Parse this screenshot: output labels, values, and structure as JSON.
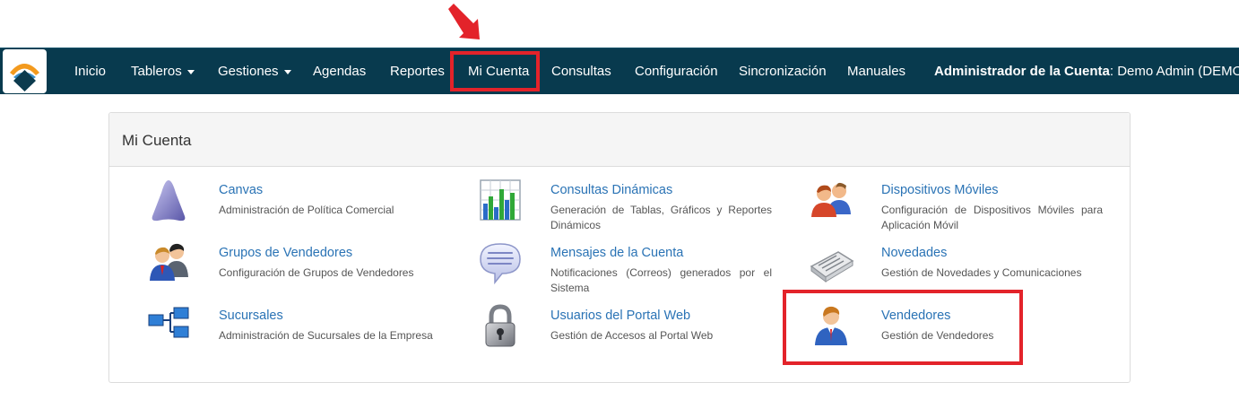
{
  "nav": {
    "items": [
      {
        "label": "Inicio",
        "dropdown": false
      },
      {
        "label": "Tableros",
        "dropdown": true
      },
      {
        "label": "Gestiones",
        "dropdown": true
      },
      {
        "label": "Agendas",
        "dropdown": false
      },
      {
        "label": "Reportes",
        "dropdown": false
      },
      {
        "label": "Mi Cuenta",
        "dropdown": false
      },
      {
        "label": "Consultas",
        "dropdown": false
      },
      {
        "label": "Configuración",
        "dropdown": false
      },
      {
        "label": "Sincronización",
        "dropdown": false
      },
      {
        "label": "Manuales",
        "dropdown": false
      }
    ],
    "account_role": "Administrador de la Cuenta",
    "account_user": ": Demo Admin (DEMO)"
  },
  "panel": {
    "title": "Mi Cuenta",
    "entries": [
      {
        "title": "Canvas",
        "desc": "Administración de Política Comercial",
        "icon": "canvas-icon"
      },
      {
        "title": "Consultas Dinámicas",
        "desc": "Generación de Tablas, Gráficos y Reportes Dinámicos",
        "icon": "bar-chart-icon"
      },
      {
        "title": "Dispositivos Móviles",
        "desc": "Configuración de Dispositivos Móviles para Aplicación Móvil",
        "icon": "users-pair-icon"
      },
      {
        "title": "Grupos de Vendedores",
        "desc": "Configuración de Grupos de Vendedores",
        "icon": "business-group-icon"
      },
      {
        "title": "Mensajes de la Cuenta",
        "desc": "Notificaciones (Correos) generados por el Sistema",
        "icon": "speech-bubble-icon"
      },
      {
        "title": "Novedades",
        "desc": "Gestión de Novedades y Comunicaciones",
        "icon": "newspaper-icon"
      },
      {
        "title": "Sucursales",
        "desc": "Administración de Sucursales de la Empresa",
        "icon": "org-tree-icon"
      },
      {
        "title": "Usuarios del Portal Web",
        "desc": "Gestión de Accesos al Portal Web",
        "icon": "padlock-icon"
      },
      {
        "title": "Vendedores",
        "desc": "Gestión de Vendedores",
        "icon": "salesman-icon"
      }
    ]
  },
  "colors": {
    "navbar": "#083a4e",
    "link": "#2a73b5",
    "annotation": "#e3232a"
  }
}
